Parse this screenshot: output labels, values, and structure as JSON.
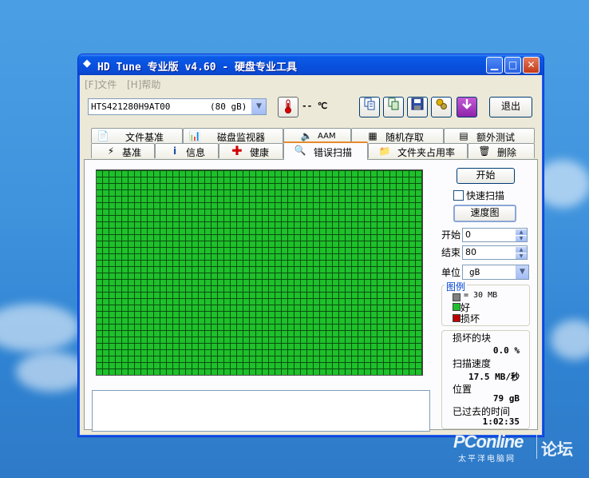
{
  "window": {
    "title": "HD Tune 专业版 v4.60 - 硬盘专业工具",
    "min_glyph": "▁",
    "max_glyph": "□",
    "close_glyph": "✕"
  },
  "menu": [
    {
      "label": "[F]文件"
    },
    {
      "label": "[H]帮助"
    }
  ],
  "toolbar": {
    "drive_name": "HTS421280H9AT00",
    "drive_capacity": "(80 gB)",
    "temperature": "-- ℃",
    "exit_label": "退出",
    "icons": [
      "thermometer-icon",
      "copy-info-icon",
      "copy-screenshot-icon",
      "save-icon",
      "options-icon",
      "download-icon"
    ]
  },
  "tabs_row1": [
    {
      "label": "文件基准",
      "icon": "file-benchmark-icon"
    },
    {
      "label": "磁盘监视器",
      "icon": "disk-monitor-icon"
    },
    {
      "label": "AAM",
      "icon": "speaker-icon"
    },
    {
      "label": "随机存取",
      "icon": "random-access-icon"
    },
    {
      "label": "额外测试",
      "icon": "extra-tests-icon"
    }
  ],
  "tabs_row2": [
    {
      "label": "基准",
      "icon": "benchmark-icon"
    },
    {
      "label": "信息",
      "icon": "info-icon"
    },
    {
      "label": "健康",
      "icon": "health-cross-icon"
    },
    {
      "label": "错误扫描",
      "icon": "magnifier-icon",
      "active": true
    },
    {
      "label": "文件夹占用率",
      "icon": "folder-icon"
    },
    {
      "label": "删除",
      "icon": "trash-icon"
    }
  ],
  "controls": {
    "start_label": "开始",
    "quick_scan_label": "快速扫描",
    "quick_scan_checked": false,
    "speed_map_label": "速度图",
    "start_field_label": "开始",
    "start_value": "0",
    "end_field_label": "结束",
    "end_value": "80",
    "unit_label": "单位",
    "unit_value": "gB"
  },
  "legend": {
    "title": "图例",
    "block_size": "= 30 MB",
    "good_label": "好",
    "bad_label": "损坏",
    "colors": {
      "block": "#808080",
      "good": "#1ec02b",
      "bad": "#c00000"
    }
  },
  "stats": {
    "damaged_label": "损坏的块",
    "damaged_value": "0.0 %",
    "speed_label": "扫描速度",
    "speed_value": "17.5 MB/秒",
    "position_label": "位置",
    "position_value": "79 gB",
    "elapsed_label": "已过去的时间",
    "elapsed_value": "1:02:35"
  },
  "watermark": {
    "brand": "PConline",
    "sub": "太平洋电脑网",
    "forum": "论坛"
  }
}
